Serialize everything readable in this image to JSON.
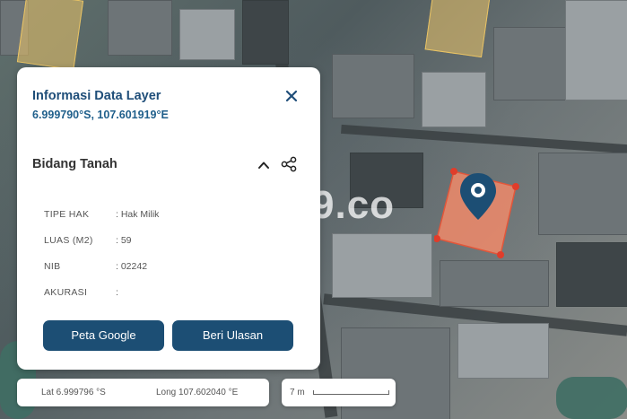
{
  "panel": {
    "title": "Informasi Data Layer",
    "coordinates": "6.999790°S, 107.601919°E",
    "section_title": "Bidang Tanah",
    "fields": [
      {
        "label": "TIPE HAK",
        "value": ": Hak Milik"
      },
      {
        "label": "LUAS (M2)",
        "value": ": 59"
      },
      {
        "label": "NIB",
        "value": ": 02242"
      },
      {
        "label": "AKURASI",
        "value": ":"
      }
    ],
    "buttons": {
      "google_map": "Peta Google",
      "review": "Beri Ulasan"
    }
  },
  "map": {
    "watermark": "9.co",
    "parcel_color": "#f08a6a",
    "pin_color": "#1c4e74"
  },
  "statusbar": {
    "lat": "Lat 6.999796 °S",
    "lng": "Long 107.602040 °E",
    "scale_label": "7 m"
  },
  "colors": {
    "primary": "#1c4e74",
    "title": "#1f4e79"
  }
}
